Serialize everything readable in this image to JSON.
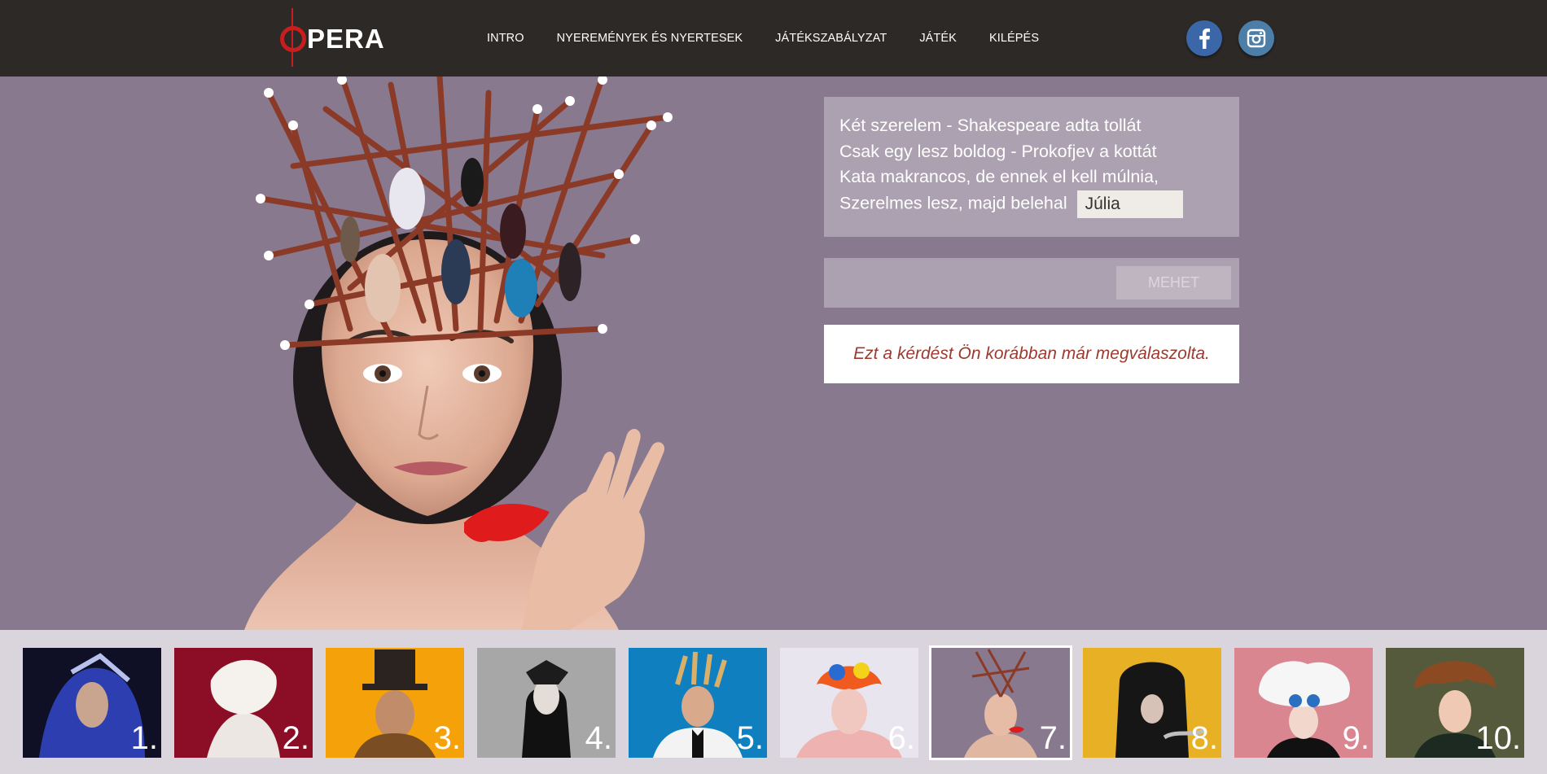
{
  "header": {
    "logo_text": "PERA",
    "nav": [
      {
        "label": "INTRO"
      },
      {
        "label": "NYEREMÉNYEK ÉS NYERTESEK"
      },
      {
        "label": "JÁTÉKSZABÁLYZAT"
      },
      {
        "label": "JÁTÉK"
      },
      {
        "label": "KILÉPÉS"
      }
    ],
    "social": {
      "facebook": "facebook-icon",
      "instagram": "instagram-icon"
    }
  },
  "quiz": {
    "lines": [
      "Két szerelem - Shakespeare adta tollát",
      "Csak egy lesz boldog - Prokofjev a kottát",
      "Kata makrancos, de ennek el kell múlnia,",
      "Szerelmes lesz, majd belehal"
    ],
    "answer_value": "Júlia",
    "submit_label": "MEHET",
    "message": "Ezt a kérdést Ön korábban már megválaszolta."
  },
  "thumbnails": [
    {
      "label": "1.",
      "bg": "#0f0f26"
    },
    {
      "label": "2.",
      "bg": "#8b0e26"
    },
    {
      "label": "3.",
      "bg": "#f5a20a"
    },
    {
      "label": "4.",
      "bg": "#a7a7a7"
    },
    {
      "label": "5.",
      "bg": "#0f7fc0"
    },
    {
      "label": "6.",
      "bg": "#e9e5ef"
    },
    {
      "label": "7.",
      "bg": "#88798f",
      "active": true
    },
    {
      "label": "8.",
      "bg": "#e8b125"
    },
    {
      "label": "9.",
      "bg": "#d98691"
    },
    {
      "label": "10.",
      "bg": "#555a3c"
    }
  ],
  "colors": {
    "header_bg": "#2c2927",
    "hero_bg": "#88798f",
    "accent_red": "#c81e1e",
    "message_text": "#9b3b2f"
  }
}
